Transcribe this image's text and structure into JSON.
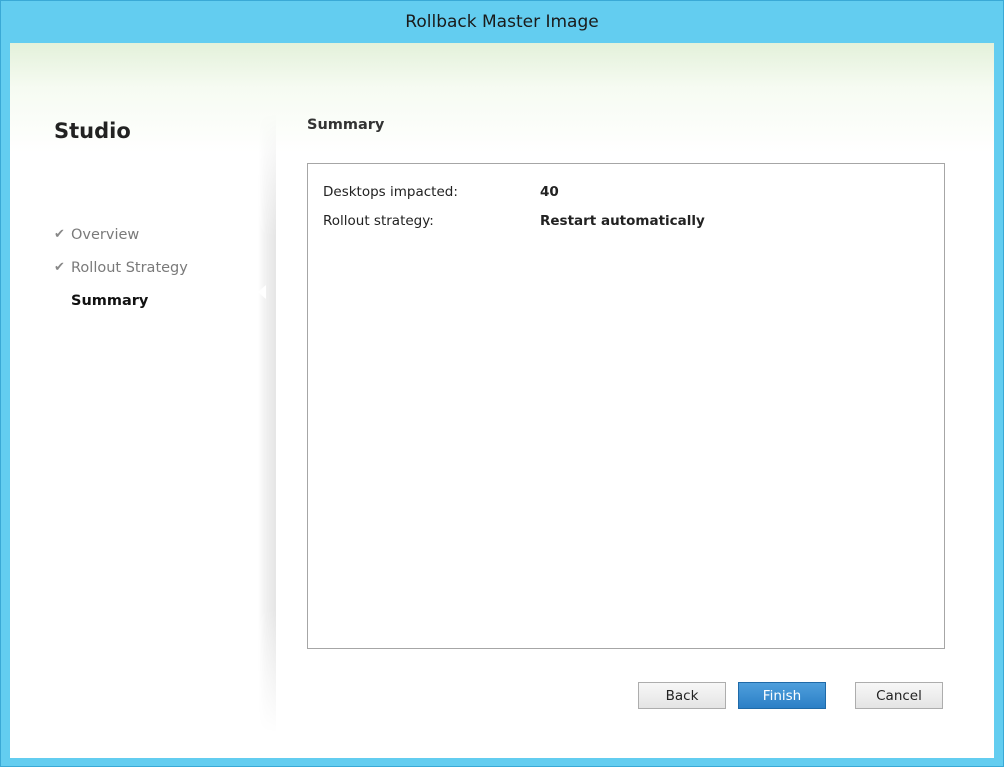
{
  "window": {
    "title": "Rollback Master Image"
  },
  "sidebar": {
    "brand": "Studio",
    "steps": [
      {
        "label": "Overview",
        "completed": true
      },
      {
        "label": "Rollout Strategy",
        "completed": true
      },
      {
        "label": "Summary",
        "completed": false,
        "active": true
      }
    ]
  },
  "main": {
    "title": "Summary",
    "rows": [
      {
        "label": "Desktops impacted:",
        "value": "40"
      },
      {
        "label": "Rollout strategy:",
        "value": "Restart automatically"
      }
    ]
  },
  "footer": {
    "back_label": "Back",
    "finish_label": "Finish",
    "cancel_label": "Cancel"
  },
  "colors": {
    "titlebar": "#63cdf0",
    "primary_button": "#2b7fc6"
  },
  "icons": {
    "completed_step": "check-icon"
  }
}
